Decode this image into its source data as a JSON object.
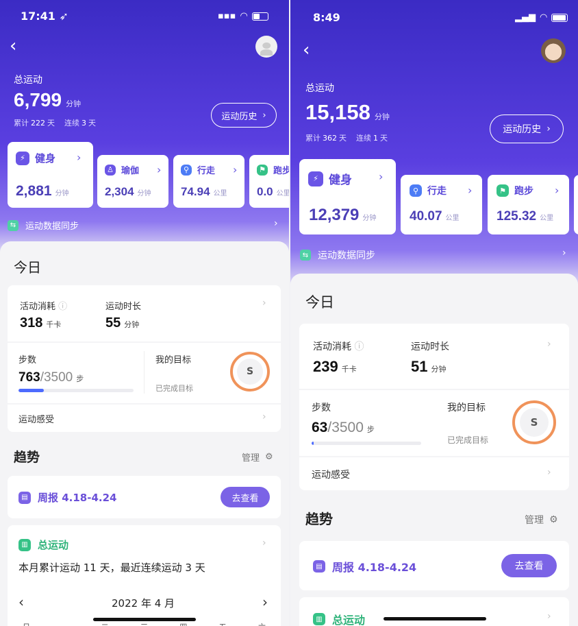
{
  "left": {
    "status": {
      "time": "17:41 ➶"
    },
    "header": {
      "total_label": "总运动",
      "total_value": "6,799",
      "total_unit": "分钟",
      "cumulative_label": "累计",
      "cumulative_value": "222",
      "day_unit": "天",
      "streak_label": "连续",
      "streak_value": "3",
      "history_button": "运动历史"
    },
    "categories": [
      {
        "name": "健身",
        "value": "2,881",
        "unit": "分钟",
        "icon": "lightning-icon",
        "color": "#6a55e6"
      },
      {
        "name": "瑜伽",
        "value": "2,304",
        "unit": "分钟",
        "icon": "yoga-icon",
        "color": "#6a55e6"
      },
      {
        "name": "行走",
        "value": "74.94",
        "unit": "公里",
        "icon": "walk-icon",
        "color": "#4d7cf5"
      },
      {
        "name": "跑步",
        "value": "0.0",
        "unit": "公里",
        "icon": "run-icon",
        "color": "#35c287"
      }
    ],
    "sync_label": "运动数据同步",
    "today": {
      "title": "今日",
      "calories_label": "活动消耗",
      "calories_value": "318",
      "calories_unit": "千卡",
      "duration_label": "运动时长",
      "duration_value": "55",
      "duration_unit": "分钟",
      "steps_label": "步数",
      "steps_value": "763",
      "steps_goal": "/3500",
      "steps_unit": "步",
      "steps_progress": 0.218,
      "goal_label": "我的目标",
      "goal_done": "已完成目标",
      "ring_letter": "S",
      "feel_label": "运动感受"
    },
    "trend": {
      "title": "趋势",
      "manage": "管理",
      "weekly_report": "周报 4.18-4.24",
      "go_button": "去查看",
      "total_title": "总运动",
      "month_summary": "本月累计运动 11 天，最近连续运动 3 天",
      "calendar_month": "2022 年 4 月",
      "weekdays": [
        "日",
        "一",
        "二",
        "三",
        "四",
        "五",
        "六"
      ]
    }
  },
  "right": {
    "status": {
      "time": "8:49"
    },
    "header": {
      "total_label": "总运动",
      "total_value": "15,158",
      "total_unit": "分钟",
      "cumulative_label": "累计",
      "cumulative_value": "362",
      "day_unit": "天",
      "streak_label": "连续",
      "streak_value": "1",
      "history_button": "运动历史"
    },
    "categories": [
      {
        "name": "健身",
        "value": "12,379",
        "unit": "分钟",
        "icon": "lightning-icon",
        "color": "#6a55e6"
      },
      {
        "name": "行走",
        "value": "40.07",
        "unit": "公里",
        "icon": "walk-icon",
        "color": "#4d7cf5"
      },
      {
        "name": "跑步",
        "value": "125.32",
        "unit": "公里",
        "icon": "run-icon",
        "color": "#35c287"
      }
    ],
    "sync_label": "运动数据同步",
    "today": {
      "title": "今日",
      "calories_label": "活动消耗",
      "calories_value": "239",
      "calories_unit": "千卡",
      "duration_label": "运动时长",
      "duration_value": "51",
      "duration_unit": "分钟",
      "steps_label": "步数",
      "steps_value": "63",
      "steps_goal": "/3500",
      "steps_unit": "步",
      "steps_progress": 0.018,
      "goal_label": "我的目标",
      "goal_done": "已完成目标",
      "ring_letter": "S",
      "feel_label": "运动感受"
    },
    "trend": {
      "title": "趋势",
      "manage": "管理",
      "weekly_report": "周报 4.18-4.24",
      "go_button": "去查看",
      "total_title": "总运动"
    }
  }
}
